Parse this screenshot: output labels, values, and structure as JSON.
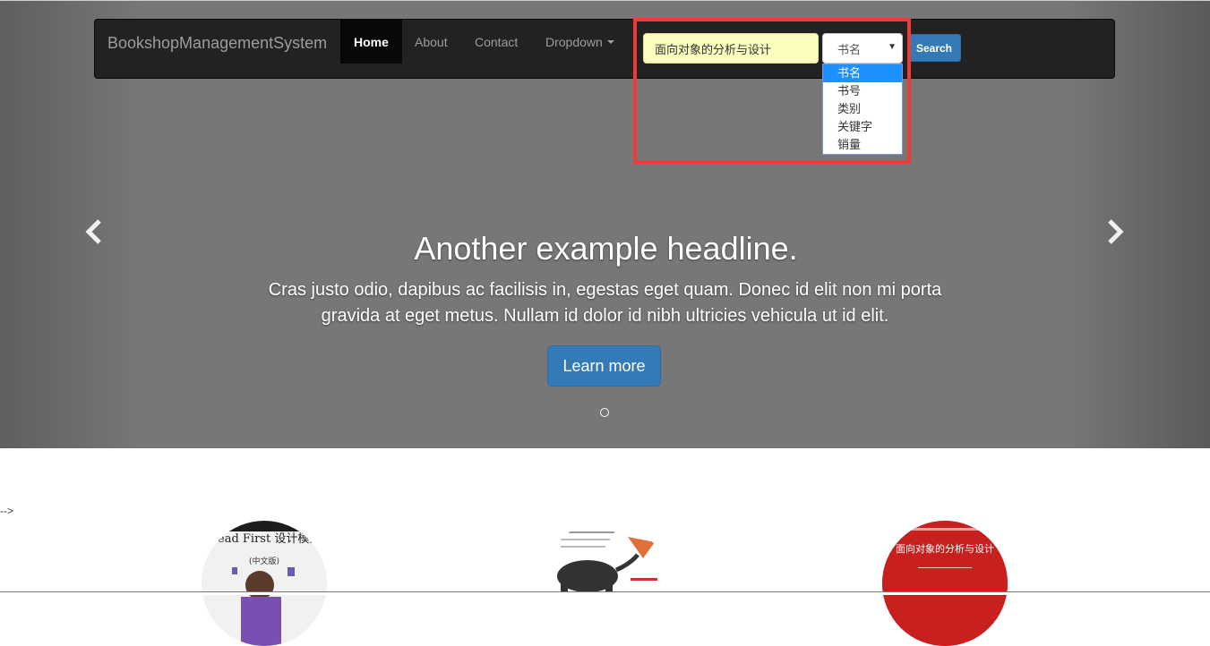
{
  "navbar": {
    "brand": "BookshopManagementSystem",
    "items": [
      {
        "label": "Home",
        "active": true
      },
      {
        "label": "About"
      },
      {
        "label": "Contact"
      },
      {
        "label": "Dropdown"
      }
    ]
  },
  "search": {
    "value": "面向对象的分析与设计",
    "select_value": "书名",
    "options": [
      "书名",
      "书号",
      "类别",
      "关键字",
      "销量"
    ],
    "button_label": "Search"
  },
  "carousel": {
    "headline": "Another example headline.",
    "text": "Cras justo odio, dapibus ac facilisis in, egestas eget quam. Donec id elit non mi porta gravida at eget metus. Nullam id dolor id nibh ultricies vehicula ut id elit.",
    "button_label": "Learn more"
  },
  "stray_text": "-->",
  "books": [
    {
      "title": "Head First 设计模式",
      "subtitle": "(中文版)"
    },
    {
      "title": ""
    },
    {
      "title": "面向对象的分析与设计"
    }
  ],
  "colors": {
    "accent": "#337ab7",
    "navbar": "#222222",
    "highlight": "#ef3a3a",
    "search_bg": "#fafdbd"
  }
}
